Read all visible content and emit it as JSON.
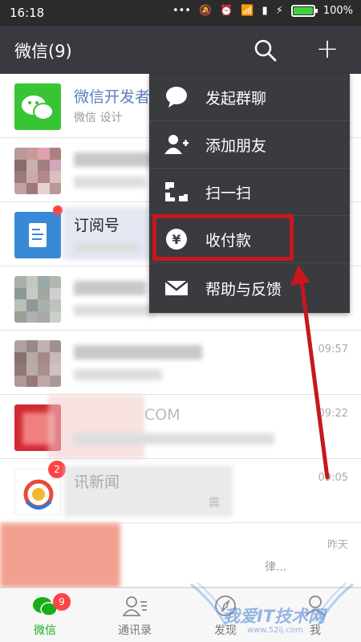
{
  "status": {
    "time": "16:18",
    "battery": "100%"
  },
  "appbar": {
    "title": "微信(9)"
  },
  "chats": [
    {
      "name": "微信开发者",
      "preview": "微信 设计",
      "time": ""
    },
    {
      "name": "",
      "preview": "",
      "time": ""
    },
    {
      "name": "订阅号",
      "preview": "",
      "time": ""
    },
    {
      "name": "",
      "preview": "",
      "time": ""
    },
    {
      "name": "",
      "preview": "",
      "time": "09:57"
    },
    {
      "name": "COM",
      "preview": "",
      "time": "09:22"
    },
    {
      "name": "讯新闻",
      "preview": "震",
      "time": "09:05",
      "badge": "2"
    },
    {
      "name": "",
      "preview": "律...",
      "time": "昨天"
    }
  ],
  "menu": {
    "items": [
      {
        "label": "发起群聊",
        "icon": "chat-bubble-icon"
      },
      {
        "label": "添加朋友",
        "icon": "add-friend-icon"
      },
      {
        "label": "扫一扫",
        "icon": "scan-icon"
      },
      {
        "label": "收付款",
        "icon": "yuan-coin-icon"
      },
      {
        "label": "帮助与反馈",
        "icon": "mail-icon"
      }
    ]
  },
  "tabs": [
    {
      "label": "微信",
      "badge": "9",
      "active": true
    },
    {
      "label": "通讯录"
    },
    {
      "label": "发现"
    },
    {
      "label": "我"
    }
  ],
  "colors": {
    "wechat_green": "#1aad19",
    "appbar": "#393a3f",
    "highlight": "#c8171e"
  },
  "watermark": {
    "text": "我爱IT技术网",
    "url": "www.52ij.com"
  }
}
